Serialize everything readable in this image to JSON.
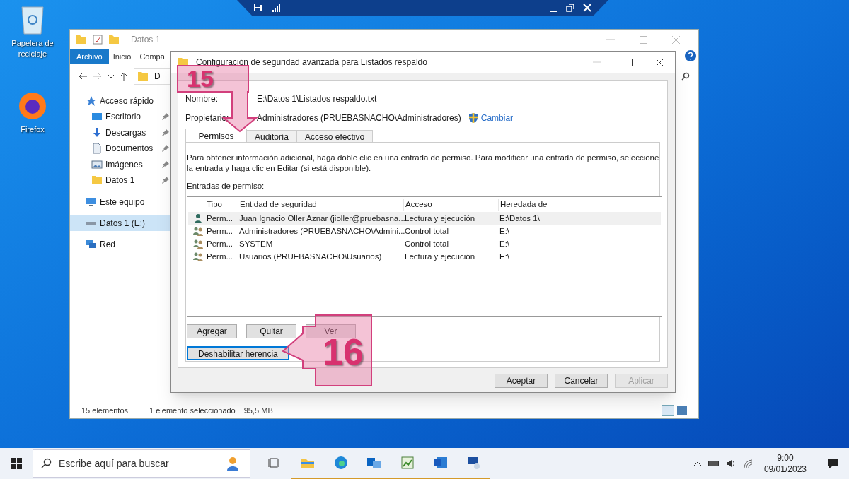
{
  "desktop_icons": [
    {
      "label": "Papelera de reciclaje",
      "kind": "recycle"
    },
    {
      "label": "Firefox",
      "kind": "browser"
    }
  ],
  "explorer": {
    "title": "Datos 1",
    "ribbon_tabs": [
      {
        "label": "Archivo",
        "selected": true
      },
      {
        "label": "Inicio",
        "selected": false
      },
      {
        "label": "Compa",
        "selected": false
      }
    ],
    "address": "D",
    "nav": [
      {
        "label": "Acceso rápido",
        "selected": false,
        "children": [
          {
            "label": "Escritorio",
            "pinned": true
          },
          {
            "label": "Descargas",
            "pinned": true
          },
          {
            "label": "Documentos",
            "pinned": true
          },
          {
            "label": "Imágenes",
            "pinned": true
          },
          {
            "label": "Datos 1",
            "pinned": true
          }
        ]
      },
      {
        "label": "Este equipo",
        "selected": false
      },
      {
        "label": "Datos 1 (E:)",
        "selected": true
      },
      {
        "label": "Red",
        "selected": false
      }
    ],
    "status": [
      "15 elementos",
      "1 elemento seleccionado",
      "95,5 MB"
    ]
  },
  "dialog": {
    "title": "Configuración de seguridad avanzada para Listados respaldo",
    "fields": [
      {
        "label": "Nombre:",
        "value": "E:\\Datos 1\\Listados respaldo.txt"
      },
      {
        "label": "Propietario:",
        "value": "Administradores (PRUEBASNACHO\\Administradores)",
        "link": "Cambiar"
      }
    ],
    "tabs": [
      {
        "label": "Permisos",
        "selected": true
      },
      {
        "label": "Auditoría",
        "selected": false
      },
      {
        "label": "Acceso efectivo",
        "selected": false
      }
    ],
    "description": "Para obtener información adicional, haga doble clic en una entrada de permiso. Para modificar una entrada de permiso, seleccione la entrada y haga clic en Editar (si está disponible).",
    "entries_label": "Entradas de permiso:",
    "columns": [
      "Tipo",
      "Entidad de seguridad",
      "Acceso",
      "Heredada de"
    ],
    "rows": [
      {
        "kind": "user",
        "selected": true,
        "cells": [
          "Perm...",
          "Juan Ignacio Oller Aznar (jioller@pruebasna...",
          "Lectura y ejecución",
          "E:\\Datos 1\\"
        ]
      },
      {
        "kind": "group",
        "selected": false,
        "cells": [
          "Perm...",
          "Administradores (PRUEBASNACHO\\Admini...",
          "Control total",
          "E:\\"
        ]
      },
      {
        "kind": "group",
        "selected": false,
        "cells": [
          "Perm...",
          "SYSTEM",
          "Control total",
          "E:\\"
        ]
      },
      {
        "kind": "group",
        "selected": false,
        "cells": [
          "Perm...",
          "Usuarios (PRUEBASNACHO\\Usuarios)",
          "Lectura y ejecución",
          "E:\\"
        ]
      }
    ],
    "entry_buttons": [
      {
        "label": "Agregar",
        "disabled": false
      },
      {
        "label": "Quitar",
        "disabled": false
      },
      {
        "label": "Ver",
        "disabled": false
      }
    ],
    "inherit_button": {
      "label": "Deshabilitar herencia",
      "focused": true
    },
    "footer_buttons": [
      {
        "label": "Aceptar",
        "disabled": false
      },
      {
        "label": "Cancelar",
        "disabled": false
      },
      {
        "label": "Aplicar",
        "disabled": true
      }
    ]
  },
  "callouts": [
    "15",
    "16"
  ],
  "taskbar": {
    "search_placeholder": "Escribe aquí para buscar",
    "apps": [
      {
        "kind": "taskview",
        "active": false
      },
      {
        "kind": "explorer",
        "active": true
      },
      {
        "kind": "browser",
        "active": true
      },
      {
        "kind": "mail",
        "active": true
      },
      {
        "kind": "sheet",
        "active": true
      },
      {
        "kind": "word",
        "active": true
      },
      {
        "kind": "remote",
        "active": true
      }
    ],
    "time": "9:00",
    "date": "09/01/2023"
  }
}
